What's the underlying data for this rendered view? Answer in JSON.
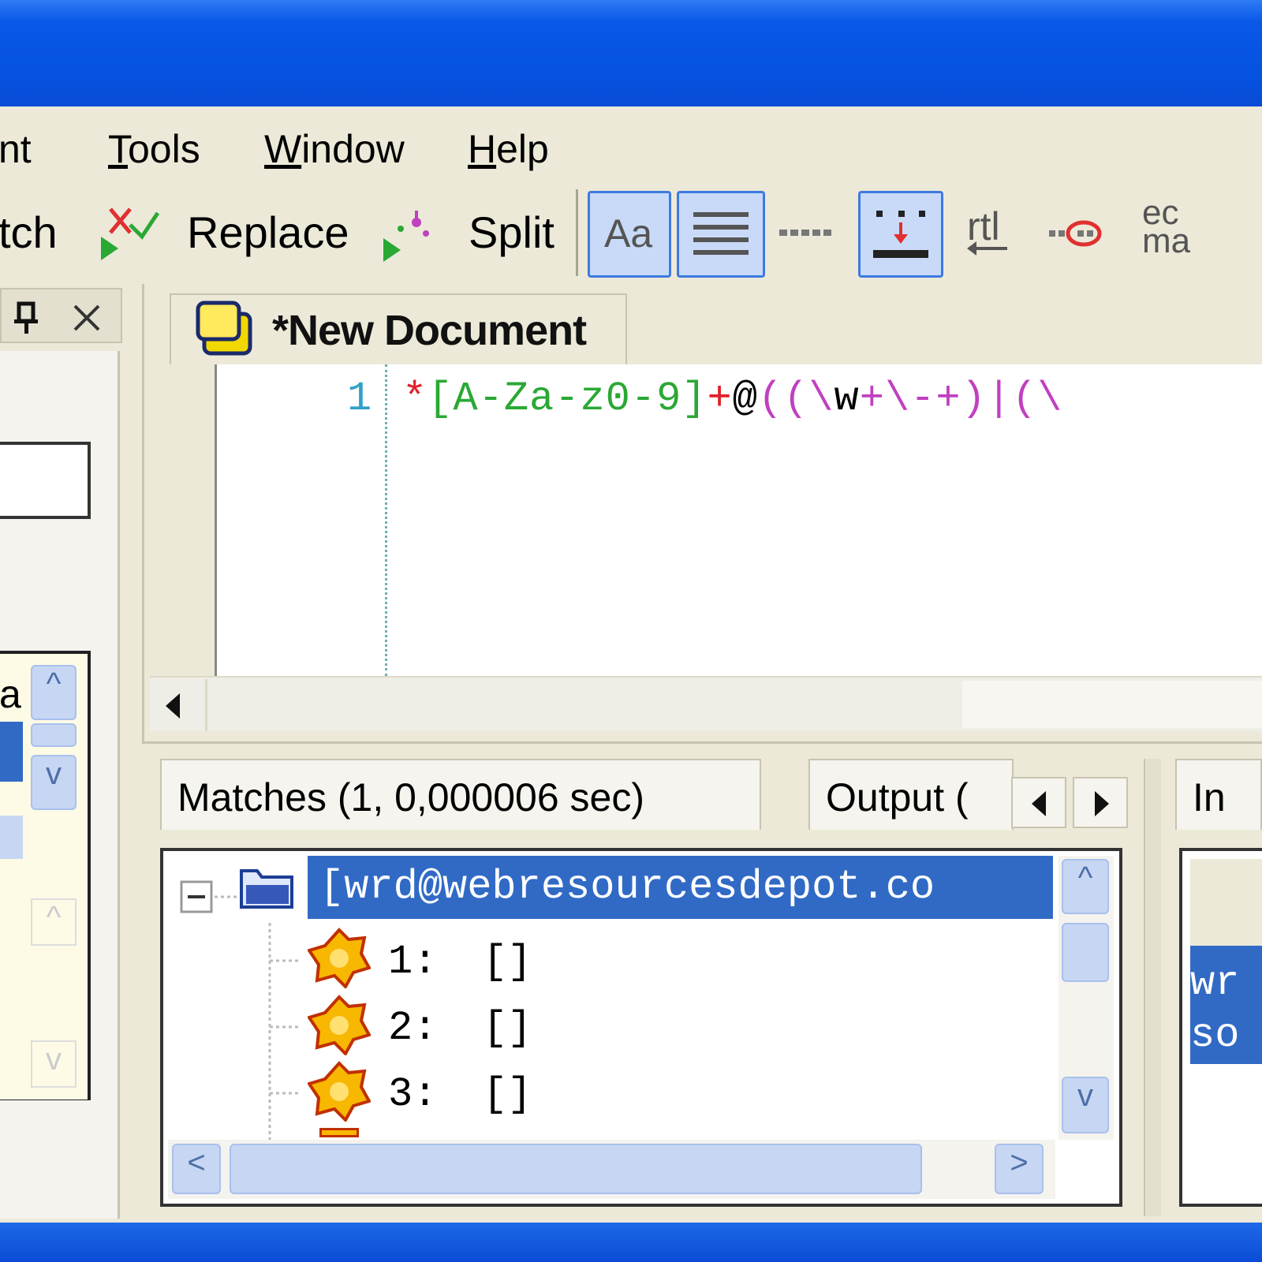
{
  "menu": {
    "items": [
      {
        "label": "nt"
      },
      {
        "label": "Tools",
        "accel": "T",
        "rest": "ools"
      },
      {
        "label": "Window",
        "accel": "W",
        "rest": "indow"
      },
      {
        "label": "Help",
        "accel": "H",
        "rest": "elp"
      }
    ]
  },
  "toolbar": {
    "match_label": "tch",
    "replace_label": "Replace",
    "split_label": "Split",
    "case_label": "Aa",
    "rtl_label": "rtl",
    "ecma_label_top": "ec",
    "ecma_label_bottom": "ma"
  },
  "left_pane": {
    "list_header_fragment": "a"
  },
  "editor": {
    "tab_title": "*New Document",
    "line_number": "1",
    "code_tokens": [
      {
        "text": "*",
        "color": "#e0202a"
      },
      {
        "text": "[A-Za-z0-9]",
        "color": "#2aa834"
      },
      {
        "text": "+",
        "color": "#e0202a"
      },
      {
        "text": "@",
        "color": "#000000"
      },
      {
        "text": "((\\",
        "color": "#c040c0"
      },
      {
        "text": "w",
        "color": "#000000"
      },
      {
        "text": "+\\-+)",
        "color": "#c040c0"
      },
      {
        "text": "|",
        "color": "#c040c0"
      },
      {
        "text": "(\\",
        "color": "#c040c0"
      }
    ]
  },
  "results": {
    "matches_tab": "Matches (1, 0,000006 sec)",
    "output_tab": "Output (",
    "input_tab": "In",
    "root_match": "[wrd@webresourcesdepot.co",
    "groups": [
      {
        "label": "1:",
        "value": "[]"
      },
      {
        "label": "2:",
        "value": "[]"
      },
      {
        "label": "3:",
        "value": "[]"
      }
    ],
    "right_text_1": "wr",
    "right_text_2": "so"
  },
  "colors": {
    "title_blue": "#0552e0",
    "selection_blue": "#316ac5",
    "chrome": "#ece9d8"
  }
}
